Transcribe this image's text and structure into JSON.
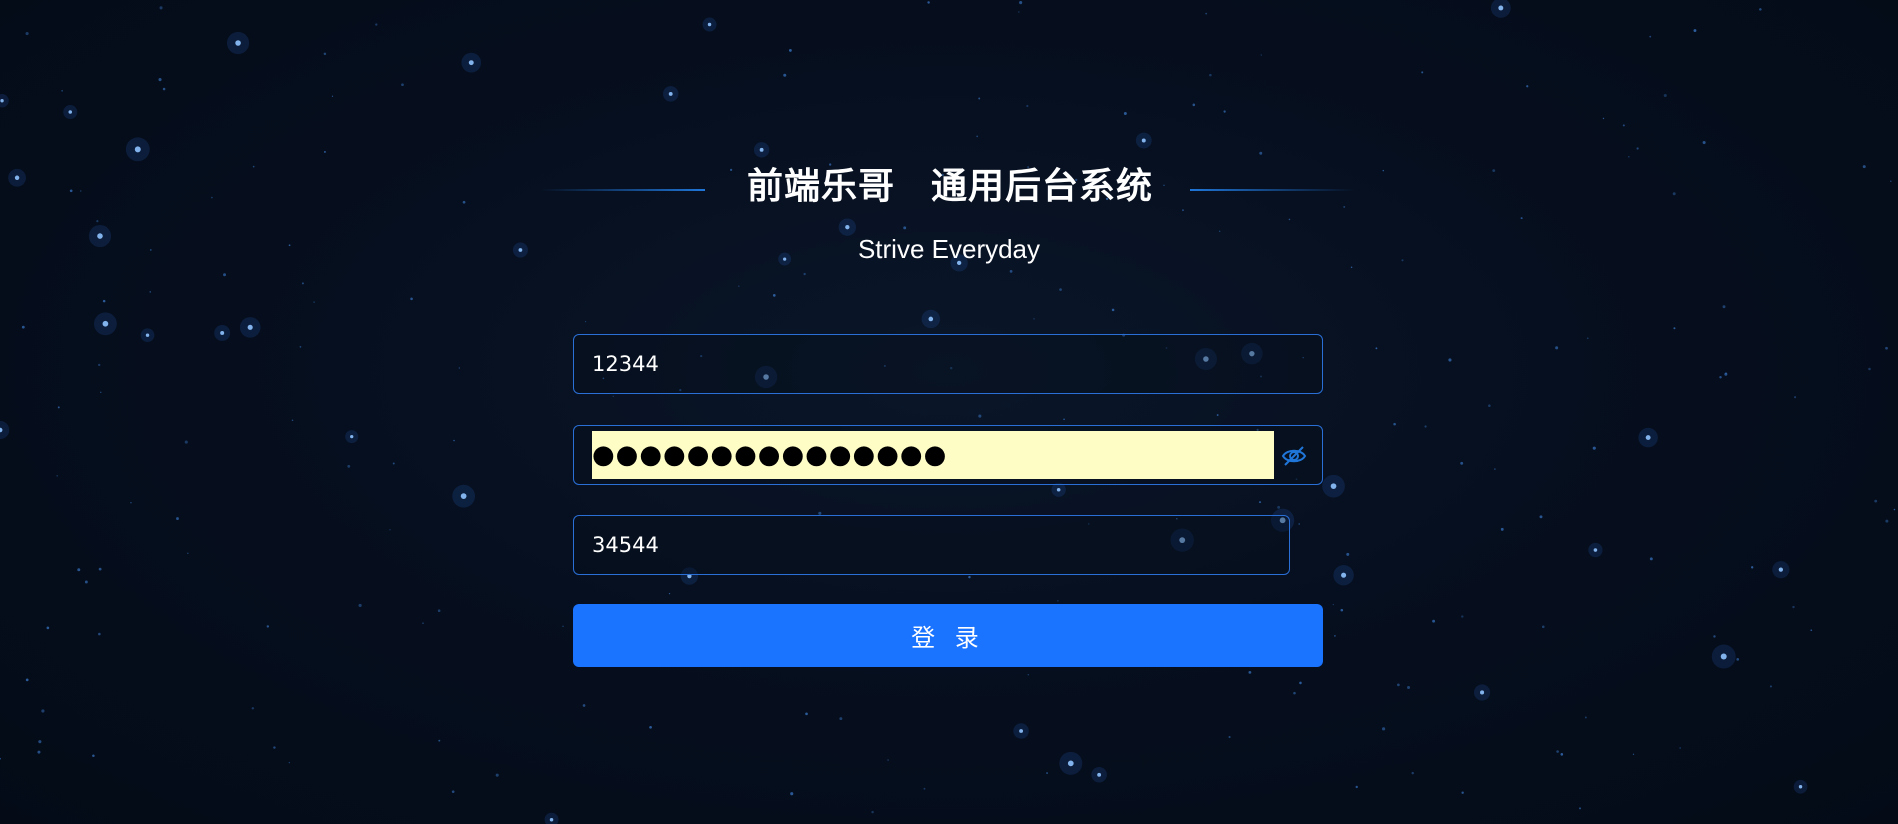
{
  "header": {
    "title_part1": "前端乐哥",
    "title_part2": "通用后台系统",
    "subtitle": "Strive Everyday"
  },
  "form": {
    "username_value": "12344",
    "password_masked": "●●●●●●●●●●●●●●●",
    "password_toggle_icon": "eye-off-icon",
    "captcha_value": "34544",
    "submit_label": "登 录"
  },
  "colors": {
    "background": "#050d1a",
    "accent": "#1a74ff",
    "field_border": "#2a6fd6",
    "autofill_bg": "#fffdc6"
  }
}
